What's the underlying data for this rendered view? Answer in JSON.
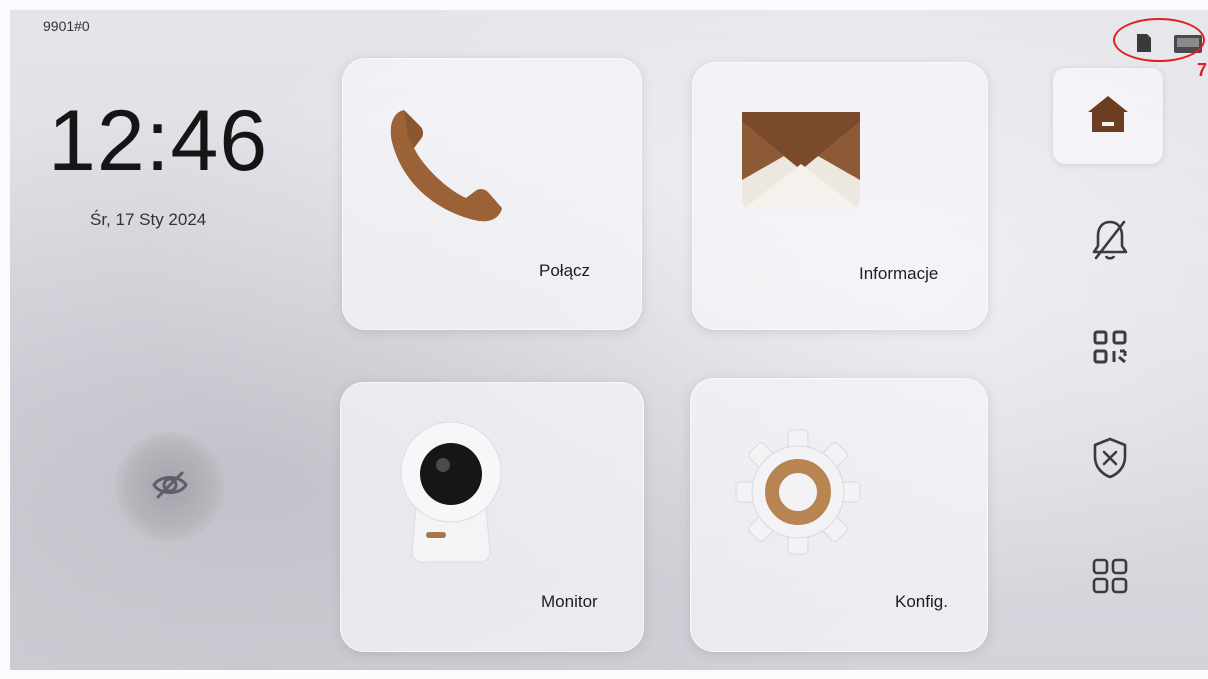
{
  "status_bar": {
    "device_id": "9901#0",
    "annotation_mark": "7"
  },
  "clock": {
    "time": "12:46",
    "date": "Śr, 17 Sty 2024"
  },
  "tiles": [
    {
      "label": "Połącz",
      "icon": "phone-icon"
    },
    {
      "label": "Informacje",
      "icon": "envelope-icon"
    },
    {
      "label": "Monitor",
      "icon": "camera-icon"
    },
    {
      "label": "Konfig.",
      "icon": "settings-gear-icon"
    }
  ],
  "sidebar": [
    {
      "name": "home",
      "icon": "home-icon",
      "active": true
    },
    {
      "name": "do-not-disturb",
      "icon": "bell-off-icon"
    },
    {
      "name": "qr-code",
      "icon": "qr-code-icon"
    },
    {
      "name": "disarm",
      "icon": "shield-x-icon"
    },
    {
      "name": "apps",
      "icon": "apps-grid-icon"
    }
  ],
  "colors": {
    "accent_brown": "#7a4a2a",
    "icon_brown": "#9a6236",
    "tile_bg": "#f0f0f5",
    "annotation_red": "#e02020"
  }
}
